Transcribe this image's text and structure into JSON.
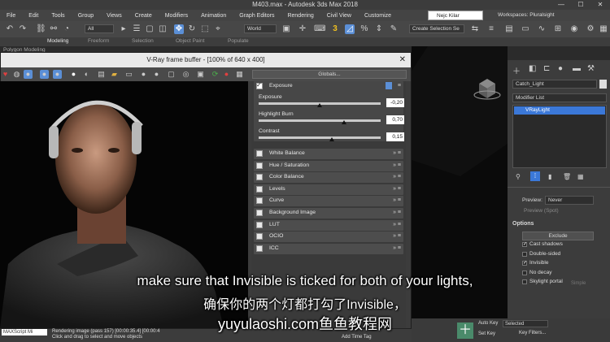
{
  "window": {
    "title": "M403.max - Autodesk 3ds Max 2018",
    "min": "—",
    "max": "☐",
    "close": "✕"
  },
  "menu": [
    "File",
    "Edit",
    "Tools",
    "Group",
    "Views",
    "Create",
    "Modifiers",
    "Animation",
    "Graph Editors",
    "Rendering",
    "Civil View",
    "Customize"
  ],
  "user": {
    "name": "Nejc Kilar",
    "workspace": "Workspaces: Pluralsight"
  },
  "toolbar": {
    "filter": "All",
    "coord": "World",
    "selection_set": "Create Selection Se"
  },
  "ribbon_tabs": [
    "Modeling",
    "Freeform",
    "Selection",
    "Object Paint",
    "Populate"
  ],
  "ribbon_sub": "Polygon Modeling",
  "vfb": {
    "title": "V-Ray frame buffer - [100% of 640 x 400]",
    "close": "✕",
    "globals": "Globals...",
    "exposure": {
      "label": "Exposure",
      "sliders": [
        {
          "label": "Exposure",
          "value": "-0,20",
          "pos": 0.5
        },
        {
          "label": "Highlight Burn",
          "value": "0,70",
          "pos": 0.7
        },
        {
          "label": "Contrast",
          "value": "0,15",
          "pos": 0.6
        }
      ]
    },
    "layers": [
      "White Balance",
      "Hue / Saturation",
      "Color Balance",
      "Levels",
      "Curve",
      "Background Image",
      "LUT",
      "OCIO",
      "ICC"
    ]
  },
  "command_panel": {
    "object_name": "Catch_Light",
    "modifier_list": "Modifier List",
    "stack_item": "VRayLight",
    "preview_label": "Preview:",
    "preview_value": "Never",
    "preview_spot": "Preview (Spot)",
    "options_title": "Options",
    "exclude": "Exclude",
    "options": [
      {
        "label": "Cast shadows",
        "checked": true
      },
      {
        "label": "Double-sided",
        "checked": false
      },
      {
        "label": "Invisible",
        "checked": true
      },
      {
        "label": "No decay",
        "checked": false
      },
      {
        "label": "Skylight portal",
        "checked": false
      }
    ],
    "simple": "Simple"
  },
  "status": {
    "maxscript": "MAXScript Mi",
    "rendering": "Rendering image (pass 157) [00:00:35.4] [00:00:4",
    "hint": "Click and drag to select and move objects",
    "add_time_tag": "Add Time Tag"
  },
  "anim": {
    "autokey": "Auto Key",
    "setkey": "Set Key",
    "selected": "Selected",
    "keyfilters": "Key Filters..."
  },
  "subtitles": {
    "en": "make sure that Invisible is ticked for both of your lights,",
    "cn": "确保你的两个灯都打勾了Invisible，",
    "watermark": "yuyulaoshi.com鱼鱼教程网"
  },
  "colors": {
    "accent": "#5b8fd6",
    "highlight": "#3b78d8"
  }
}
